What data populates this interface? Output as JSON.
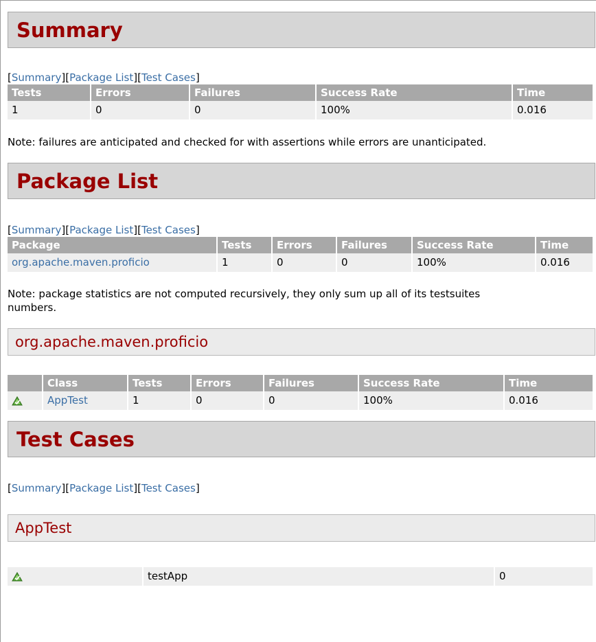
{
  "nav": {
    "open": "[",
    "sep": "][",
    "close": "]",
    "summary": "Summary",
    "package_list": "Package List",
    "test_cases": "Test Cases"
  },
  "summary": {
    "title": "Summary",
    "headers": [
      "Tests",
      "Errors",
      "Failures",
      "Success Rate",
      "Time"
    ],
    "row": [
      "1",
      "0",
      "0",
      "100%",
      "0.016"
    ],
    "note": "Note: failures are anticipated and checked for with assertions while errors are unanticipated."
  },
  "package_list": {
    "title": "Package List",
    "headers": [
      "Package",
      "Tests",
      "Errors",
      "Failures",
      "Success Rate",
      "Time"
    ],
    "row": [
      "org.apache.maven.proficio",
      "1",
      "0",
      "0",
      "100%",
      "0.016"
    ],
    "note": "Note: package statistics are not computed recursively, they only sum up all of its testsuites numbers."
  },
  "package_section": {
    "title": "org.apache.maven.proficio",
    "headers": [
      "",
      "Class",
      "Tests",
      "Errors",
      "Failures",
      "Success Rate",
      "Time"
    ],
    "row": [
      "",
      "AppTest",
      "1",
      "0",
      "0",
      "100%",
      "0.016"
    ],
    "status_icon": "success-icon"
  },
  "test_cases": {
    "title": "Test Cases",
    "class_title": "AppTest",
    "row": [
      "",
      "testApp",
      "0"
    ],
    "status_icon": "success-icon"
  },
  "colors": {
    "heading": "#990000",
    "link": "#3a6ea5",
    "header_bg": "#a8a8a8",
    "row_bg": "#eeeeee"
  }
}
